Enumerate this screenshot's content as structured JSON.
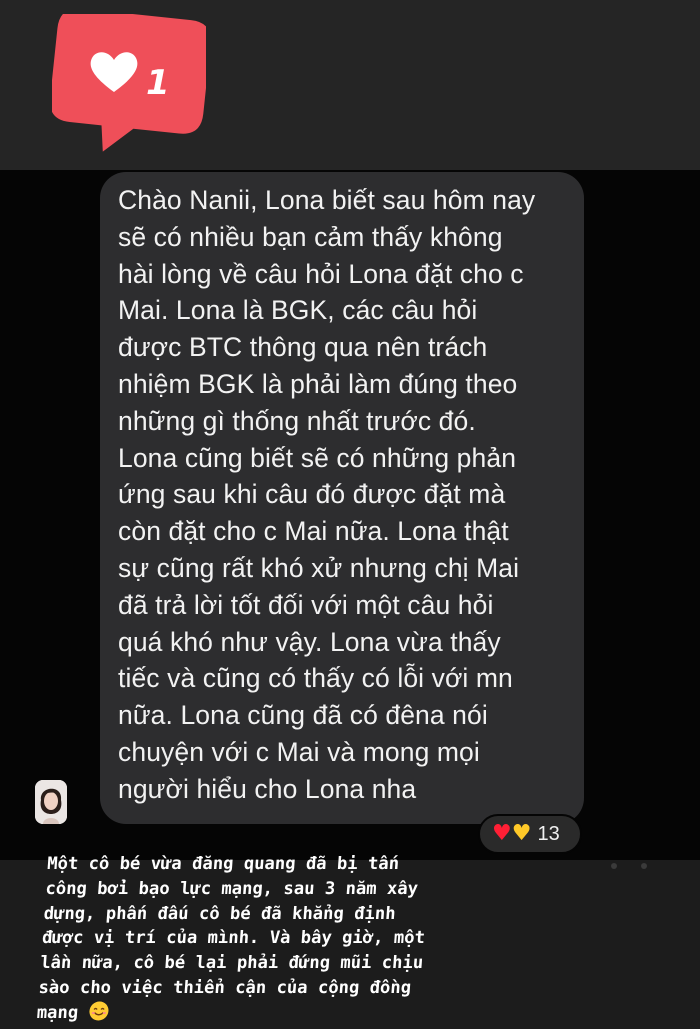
{
  "like_sticker": {
    "icon": "heart-icon",
    "count": "1",
    "color": "#ef4f59"
  },
  "message": {
    "text": "Chào Nanii, Lona biết sau hôm nay\nsẽ có nhiều bạn cảm thấy không\nhài lòng về câu hỏi Lona đặt cho c\nMai. Lona là BGK, các câu hỏi\nđược BTC thông qua nên trách\nnhiệm BGK là phải làm đúng theo\nnhững gì thống nhất trước đó.\nLona cũng biết sẽ có những phản\nứng sau khi câu đó được đặt mà\ncòn đặt cho c Mai nữa. Lona thật\nsự cũng rất khó xử nhưng chị Mai\nđã trả lời tốt đối với một câu hỏi\nquá khó như vậy. Lona vừa thấy\ntiếc và cũng có thấy có lỗi với mn\nnữa. Lona cũng đã có đêna nói\nchuyện với c Mai và mong mọi\nngười hiểu cho Lona nha",
    "bubble_color": "#2d2d2f"
  },
  "reactions": {
    "icons": [
      "red-heart-icon",
      "yellow-heart-icon"
    ],
    "count": "13"
  },
  "story_caption": {
    "text": "Một cô bé vừa đăng quang đã bị tấn\ncông bởi bạo lực mạng, sau 3 năm xây\ndựng, phấn đấu cô bé đã khẳng định\nđược vị trí của mình. Và bây giờ, một\nlần nữa, cô bé lại phải đứng mũi chịu\nsào cho việc thiển cận của cộng đồng\nmạng",
    "emoji": "smiling-face-icon"
  }
}
